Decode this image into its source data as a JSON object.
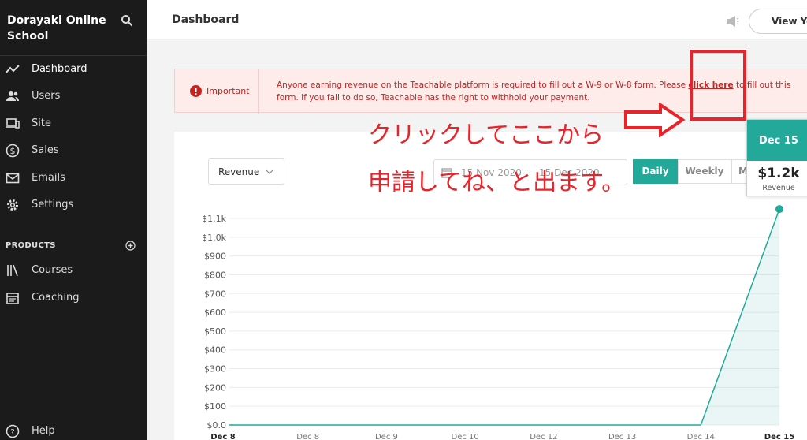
{
  "sidebar": {
    "school_name": "Dorayaki Online School",
    "nav": [
      {
        "label": "Dashboard",
        "icon": "trend-icon"
      },
      {
        "label": "Users",
        "icon": "users-icon"
      },
      {
        "label": "Site",
        "icon": "devices-icon"
      },
      {
        "label": "Sales",
        "icon": "dollar-icon"
      },
      {
        "label": "Emails",
        "icon": "mail-icon"
      },
      {
        "label": "Settings",
        "icon": "gear-icon"
      }
    ],
    "products_label": "PRODUCTS",
    "products_nav": [
      {
        "label": "Courses",
        "icon": "library-icon"
      },
      {
        "label": "Coaching",
        "icon": "calendar-icon"
      }
    ],
    "help_label": "Help"
  },
  "header": {
    "title": "Dashboard",
    "view_button": "View Yo"
  },
  "alert": {
    "title": "Important",
    "message_before": "Anyone earning revenue on the Teachable platform is required to fill out a W-9 or W-8 form. Please ",
    "link": "click here",
    "message_after": " to fill out this form. If you fail to do so, Teachable has the right to withhold your payment."
  },
  "card": {
    "metric": "Revenue",
    "date_start": "15 Nov 2020",
    "date_sep": "-",
    "date_end": "15 Dec 2020",
    "tabs": [
      "Daily",
      "Weekly",
      "M"
    ]
  },
  "tooltip": {
    "date": "Dec 15",
    "value": "$1.2k",
    "label": "Revenue"
  },
  "annotation": {
    "line1": "クリックしてここから",
    "line2": "申請してね、と出ます。"
  },
  "colors": {
    "accent": "#23a99a",
    "alert": "#c52222",
    "annotation": "#e8232a"
  },
  "chart_data": {
    "type": "area",
    "x": [
      "Dec 8",
      "Dec 8",
      "Dec 9",
      "Dec 10",
      "Dec 12",
      "Dec 13",
      "Dec 14",
      "Dec 15"
    ],
    "values": [
      0,
      0,
      0,
      0,
      0,
      0,
      0,
      1150
    ],
    "y_ticks": [
      "$0.0",
      "$100",
      "$200",
      "$300",
      "$400",
      "$500",
      "$600",
      "$700",
      "$800",
      "$900",
      "$1.0k",
      "$1.1k"
    ],
    "ylim": [
      0,
      1100
    ],
    "grid": true
  }
}
